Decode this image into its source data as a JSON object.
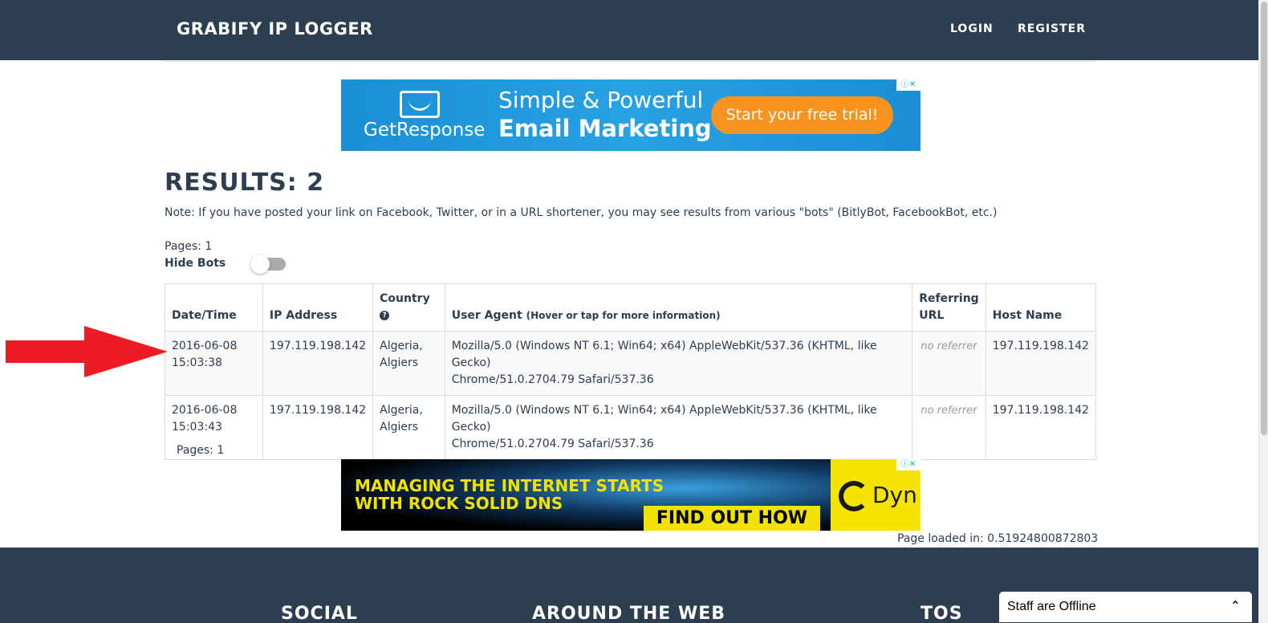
{
  "header": {
    "brand": "GRABIFY IP LOGGER",
    "login": "LOGIN",
    "register": "REGISTER"
  },
  "ad_top": {
    "brand": "GetResponse",
    "line1": "Simple & Powerful",
    "line2": "Email Marketing",
    "cta": "Start your free trial!"
  },
  "results": {
    "title": "RESULTS: 2",
    "note": "Note: If you have posted your link on Facebook, Twitter, or in a URL shortener, you may see results from various \"bots\" (BitlyBot, FacebookBot, etc.)",
    "pages_top": "Pages: 1",
    "hide_bots": "Hide Bots",
    "hide_bots_on": false,
    "pages_bottom": "Pages: 1"
  },
  "table": {
    "headers": {
      "datetime": "Date/Time",
      "ip": "IP Address",
      "country": "Country",
      "ua": "User Agent",
      "ua_hint": "(Hover or tap for more information)",
      "ref_line1": "Referring",
      "ref_line2": "URL",
      "host": "Host Name"
    },
    "rows": [
      {
        "date": "2016-06-08",
        "time": "15:03:38",
        "ip": "197.119.198.142",
        "country_line1": "Algeria,",
        "country_line2": "Algiers",
        "ua_line1": "Mozilla/5.0 (Windows NT 6.1; Win64; x64) AppleWebKit/537.36 (KHTML, like Gecko)",
        "ua_line2": "Chrome/51.0.2704.79 Safari/537.36",
        "referrer": "no referrer",
        "host": "197.119.198.142"
      },
      {
        "date": "2016-06-08",
        "time": "15:03:43",
        "ip": "197.119.198.142",
        "country_line1": "Algeria,",
        "country_line2": "Algiers",
        "ua_line1": "Mozilla/5.0 (Windows NT 6.1; Win64; x64) AppleWebKit/537.36 (KHTML, like Gecko)",
        "ua_line2": "Chrome/51.0.2704.79 Safari/537.36",
        "referrer": "no referrer",
        "host": "197.119.198.142"
      }
    ]
  },
  "ad_bottom": {
    "line1": "MANAGING THE INTERNET STARTS",
    "line2": "WITH ROCK SOLID DNS",
    "cta": "FIND OUT HOW",
    "brand": "Dyn"
  },
  "page_loaded": "Page loaded in: 0.51924800872803",
  "footer": {
    "social": "SOCIAL",
    "around": "AROUND THE WEB",
    "tos": "TOS"
  },
  "chat": {
    "status": "Staff are Offline"
  },
  "colors": {
    "navbar": "#2c3e50",
    "arrow": "#ed1c24",
    "getresponse_blue": "#1a8fd6",
    "cta_orange": "#f7931e",
    "dyn_yellow": "#f5e400"
  },
  "icons": {
    "country_help": "question-circle-icon",
    "chat_toggle": "chevron-up-icon",
    "ad_info": "ad-choices-icon"
  }
}
